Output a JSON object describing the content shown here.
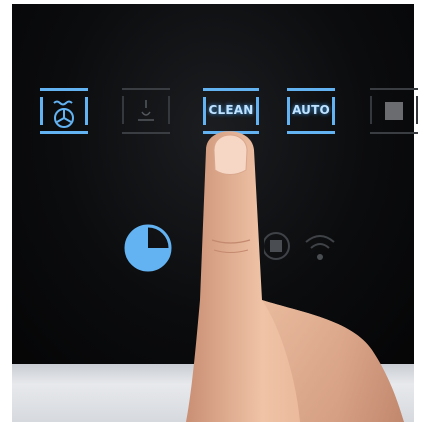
{
  "panel": {
    "buttons": [
      {
        "icon": "fan-bake-icon",
        "label": "",
        "lit": true
      },
      {
        "icon": "broil-icon",
        "label": "",
        "lit": false
      },
      {
        "icon": "",
        "label": "CLEAN",
        "lit": true
      },
      {
        "icon": "",
        "label": "AUTO",
        "lit": true
      },
      {
        "icon": "stop-square-icon",
        "label": "",
        "lit": false
      }
    ],
    "indicators": [
      "timer-icon",
      "stop-circle-icon",
      "wifi-icon"
    ]
  },
  "colors": {
    "glow_blue": "#63b3f3",
    "panel_black": "#0b0c0e",
    "dim_gray": "#3a3d42",
    "skin": "#e7b79a"
  }
}
